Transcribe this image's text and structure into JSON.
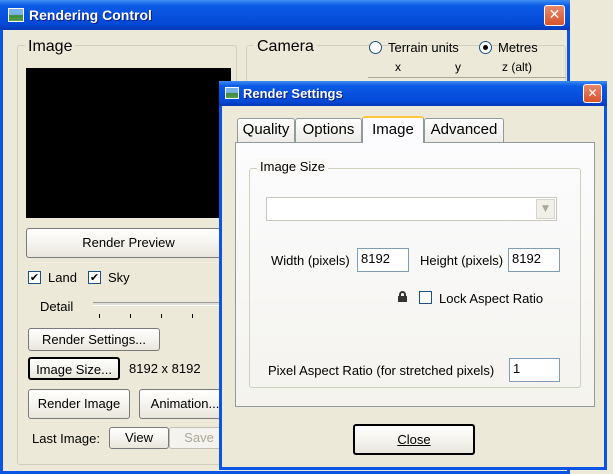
{
  "rendering_control": {
    "title": "Rendering Control",
    "image_group_label": "Image",
    "render_preview_label": "Render Preview",
    "land_label": "Land",
    "land_checked": true,
    "sky_label": "Sky",
    "sky_checked": true,
    "detail_label": "Detail",
    "render_settings_label": "Render Settings...",
    "image_size_label": "Image Size...",
    "image_size_value": "8192 x 8192",
    "render_image_label": "Render Image",
    "animation_label": "Animation...",
    "last_image_label": "Last Image:",
    "view_label": "View",
    "save_label": "Save",
    "camera_group_label": "Camera",
    "terrain_units_label": "Terrain units",
    "metres_label": "Metres",
    "units_selected": "Metres",
    "col_x": "x",
    "col_y": "y",
    "col_z": "z (alt)"
  },
  "render_settings": {
    "title": "Render Settings",
    "tabs": [
      {
        "label": "Quality",
        "active": false
      },
      {
        "label": "Options",
        "active": false
      },
      {
        "label": "Image",
        "active": true
      },
      {
        "label": "Advanced",
        "active": false
      }
    ],
    "image_size_group_label": "Image Size",
    "preset_value": "",
    "width_label": "Width (pixels)",
    "width_value": "8192",
    "height_label": "Height (pixels)",
    "height_value": "8192",
    "lock_aspect_label": "Lock Aspect Ratio",
    "lock_aspect_checked": false,
    "pixel_aspect_label": "Pixel Aspect Ratio (for stretched pixels)",
    "pixel_aspect_value": "1",
    "close_label": "Close"
  },
  "colors": {
    "title_blue": "#0a55e5",
    "face": "#ece9d8",
    "close_red": "#d9532c",
    "focus_orange": "#ffc83c"
  }
}
